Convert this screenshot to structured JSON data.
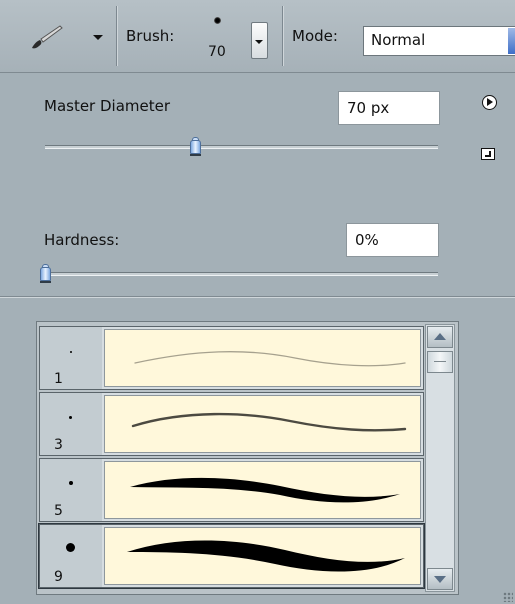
{
  "toolbar": {
    "tool_icon": "brush-tool-icon",
    "brush_label": "Brush:",
    "brush_size": "70",
    "mode_label": "Mode:",
    "mode_value": "Normal"
  },
  "master_diameter": {
    "label": "Master Diameter",
    "value": "70 px",
    "slider_fraction": 0.38
  },
  "hardness": {
    "label": "Hardness:",
    "value": "0%",
    "slider_fraction": 0.0
  },
  "presets": [
    {
      "size": "1"
    },
    {
      "size": "3"
    },
    {
      "size": "5"
    },
    {
      "size": "9"
    }
  ],
  "colors": {
    "panel": "#a4b0b7",
    "stroke_bg": "#fff8db",
    "accent": "#3f6fc8"
  }
}
